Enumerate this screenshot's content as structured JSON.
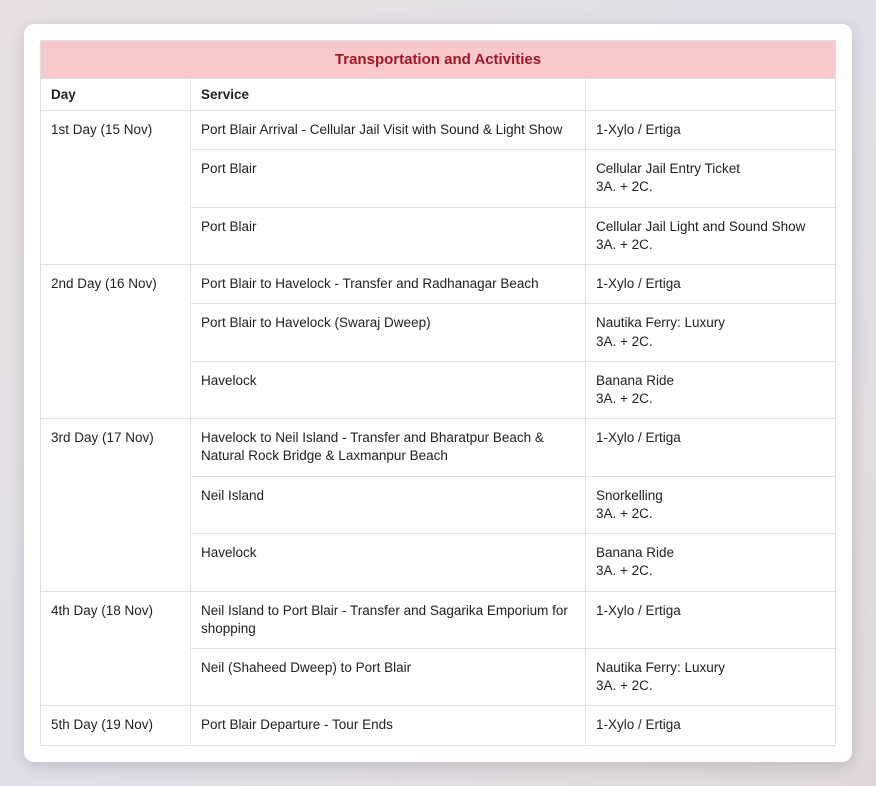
{
  "title": "Transportation and Activities",
  "headers": {
    "day": "Day",
    "service": "Service"
  },
  "days": [
    {
      "label": "1st Day (15 Nov)",
      "rows": [
        {
          "service": "Port Blair Arrival - Cellular Jail Visit with Sound & Light Show",
          "detail": "1-Xylo / Ertiga",
          "sub": ""
        },
        {
          "service": "Port Blair",
          "detail": "Cellular Jail Entry Ticket",
          "sub": "3A. + 2C."
        },
        {
          "service": "Port Blair",
          "detail": "Cellular Jail Light and Sound Show",
          "sub": "3A. + 2C."
        }
      ]
    },
    {
      "label": "2nd Day (16 Nov)",
      "rows": [
        {
          "service": "Port Blair to Havelock - Transfer and Radhanagar Beach",
          "detail": "1-Xylo / Ertiga",
          "sub": ""
        },
        {
          "service": "Port Blair to Havelock (Swaraj Dweep)",
          "detail": "Nautika Ferry: Luxury",
          "sub": "3A. + 2C."
        },
        {
          "service": "Havelock",
          "detail": "Banana Ride",
          "sub": "3A. + 2C."
        }
      ]
    },
    {
      "label": "3rd Day (17 Nov)",
      "rows": [
        {
          "service": "Havelock to Neil Island - Transfer and Bharatpur Beach & Natural Rock Bridge & Laxmanpur Beach",
          "detail": "1-Xylo / Ertiga",
          "sub": ""
        },
        {
          "service": "Neil Island",
          "detail": "Snorkelling",
          "sub": "3A. + 2C."
        },
        {
          "service": "Havelock",
          "detail": "Banana Ride",
          "sub": "3A. + 2C."
        }
      ]
    },
    {
      "label": "4th Day (18 Nov)",
      "rows": [
        {
          "service": "Neil Island to Port Blair - Transfer and Sagarika Emporium for shopping",
          "detail": "1-Xylo / Ertiga",
          "sub": ""
        },
        {
          "service": "Neil (Shaheed Dweep) to Port Blair",
          "detail": "Nautika Ferry: Luxury",
          "sub": "3A. + 2C."
        }
      ]
    },
    {
      "label": "5th Day (19 Nov)",
      "rows": [
        {
          "service": "Port Blair Departure - Tour Ends",
          "detail": "1-Xylo / Ertiga",
          "sub": ""
        }
      ]
    }
  ]
}
